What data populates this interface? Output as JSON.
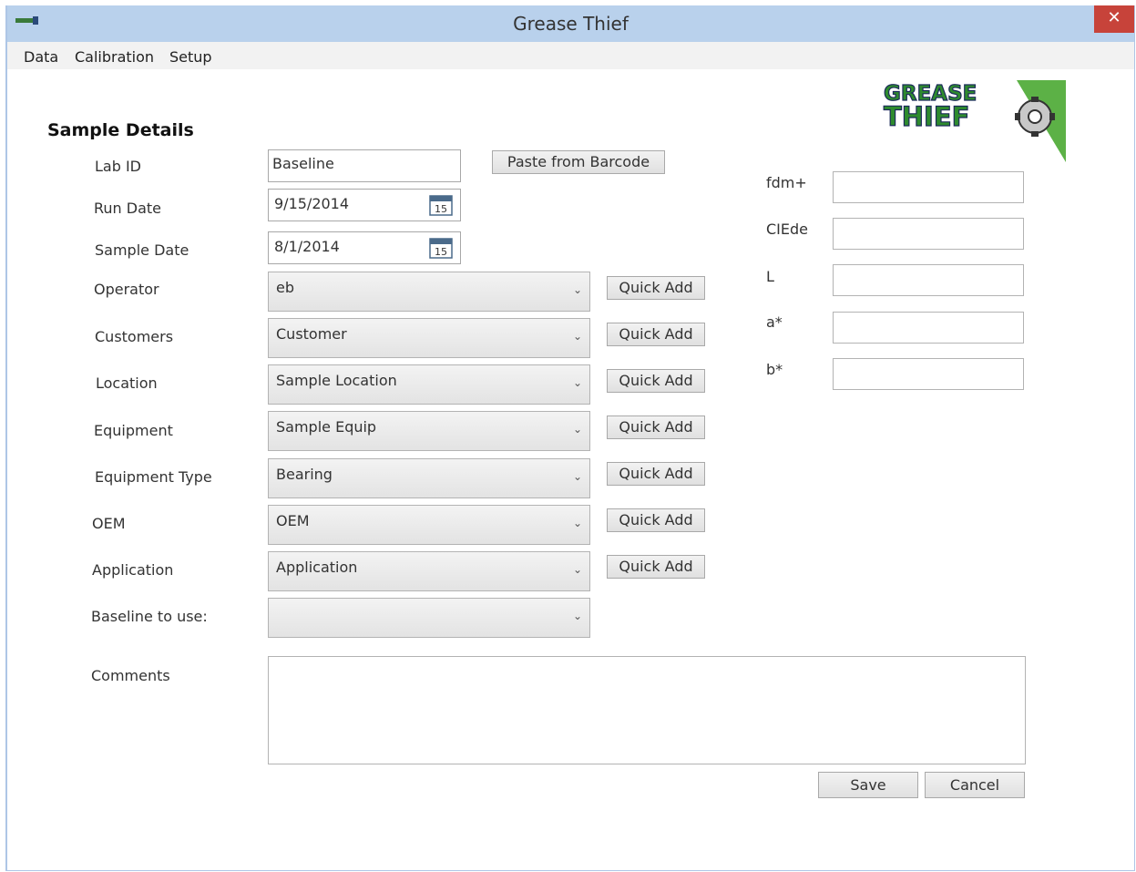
{
  "window": {
    "title": "Grease Thief",
    "close_glyph": "✕"
  },
  "menu": [
    "Data",
    "Calibration",
    "Setup"
  ],
  "logo": {
    "line1": "GREASE",
    "line2": "THIEF"
  },
  "section_title": "Sample Details",
  "fields": {
    "lab_id": {
      "label": "Lab ID",
      "value": "Baseline"
    },
    "run_date": {
      "label": "Run Date",
      "value": "9/15/2014"
    },
    "sample_date": {
      "label": "Sample Date",
      "value": "8/1/2014"
    },
    "calendar_day": "15"
  },
  "paste_button": "Paste from Barcode",
  "combos": [
    {
      "label": "Operator",
      "value": "eb",
      "quick_add": "Quick Add"
    },
    {
      "label": "Customers",
      "value": "Customer",
      "quick_add": "Quick Add"
    },
    {
      "label": "Location",
      "value": "Sample Location",
      "quick_add": "Quick Add"
    },
    {
      "label": "Equipment",
      "value": "Sample Equip",
      "quick_add": "Quick Add"
    },
    {
      "label": "Equipment Type",
      "value": "Bearing",
      "quick_add": "Quick Add"
    },
    {
      "label": "OEM",
      "value": "OEM",
      "quick_add": "Quick Add"
    },
    {
      "label": "Application",
      "value": "Application",
      "quick_add": "Quick Add"
    },
    {
      "label": "Baseline to use:",
      "value": ""
    }
  ],
  "chevron_glyph": "⌄",
  "metrics": [
    {
      "label": "fdm+",
      "value": ""
    },
    {
      "label": "CIEde",
      "value": ""
    },
    {
      "label": "L",
      "value": ""
    },
    {
      "label": "a*",
      "value": ""
    },
    {
      "label": "b*",
      "value": ""
    }
  ],
  "comments": {
    "label": "Comments",
    "value": ""
  },
  "actions": {
    "save": "Save",
    "cancel": "Cancel"
  },
  "colors": {
    "titlebar": "#b9d1ec",
    "close": "#c7433a",
    "logo_green": "#2e8b2e",
    "logo_navy": "#1b2a5a"
  }
}
